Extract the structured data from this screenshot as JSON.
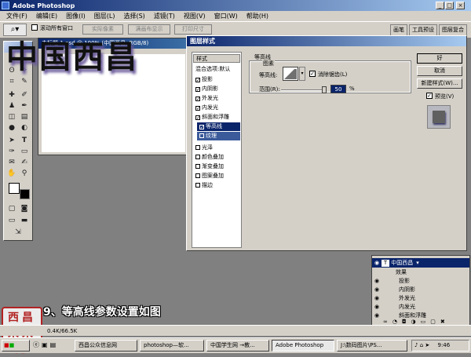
{
  "app": {
    "title": "Adobe Photoshop"
  },
  "menu": [
    "文件(F)",
    "编辑(E)",
    "图像(I)",
    "图层(L)",
    "选择(S)",
    "滤镜(T)",
    "视图(V)",
    "窗口(W)",
    "帮助(H)"
  ],
  "options": {
    "resize_all_label": "滚动所有窗口",
    "btn_actual": "实际像素",
    "btn_fit": "满画布显示",
    "btn_print": "打印尺寸",
    "tabs": [
      "画笔",
      "工具预设",
      "图层复合"
    ]
  },
  "document": {
    "title": "未标题-1.psd @ 100% (中国西昌, RGB/8)",
    "canvas_text": "中国西昌"
  },
  "dialog": {
    "title": "图层样式",
    "list_header": "样式",
    "list_blend": "混合选项:默认",
    "styles": [
      {
        "label": "投影",
        "checked": true
      },
      {
        "label": "内阴影",
        "checked": true
      },
      {
        "label": "外发光",
        "checked": true
      },
      {
        "label": "内发光",
        "checked": true
      },
      {
        "label": "斜面和浮雕",
        "checked": true
      },
      {
        "label": "等高线",
        "checked": true
      },
      {
        "label": "纹理",
        "checked": false
      },
      {
        "label": "光泽",
        "checked": false
      },
      {
        "label": "颜色叠加",
        "checked": false
      },
      {
        "label": "渐变叠加",
        "checked": false
      },
      {
        "label": "图案叠加",
        "checked": false
      },
      {
        "label": "描边",
        "checked": false
      }
    ],
    "section_title": "等高线",
    "group_title": "图素",
    "contour_label": "等高线:",
    "antialias_label": "消除锯齿(L)",
    "range_label": "范围(R):",
    "range_value": "50",
    "range_unit": "%",
    "btn_ok": "好",
    "btn_cancel": "取消",
    "btn_new": "新建样式(W)...",
    "preview_label": "预览(V)"
  },
  "layers": {
    "layer_name": "中国西昌",
    "effects_label": "效果",
    "effects": [
      "投影",
      "内阴影",
      "外发光",
      "内发光",
      "斜面和浮雕"
    ]
  },
  "caption": "9、等高线参数设置如图",
  "seal": "西昌 采采览",
  "status": "0.4K/66.5K",
  "taskbar": {
    "items": [
      "西昌公众信息网",
      "photoshop—软...",
      "中国学生网 →教...",
      "Adobe Photoshop",
      "J:\\数码图片\\PS..."
    ],
    "clock": "9:46"
  }
}
